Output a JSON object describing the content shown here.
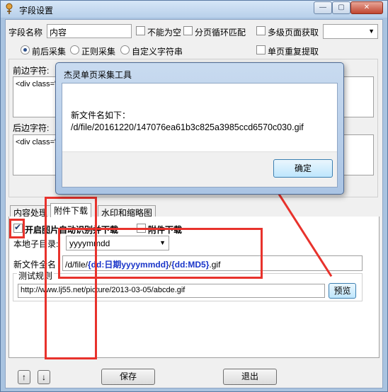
{
  "window": {
    "title": "字段设置",
    "min_glyph": "—",
    "max_glyph": "▢",
    "close_glyph": "✕"
  },
  "top": {
    "field_name_label": "字段名称",
    "field_name_value": "内容",
    "not_empty_label": "不能为空",
    "page_loop_label": "分页循环匹配",
    "multi_page_label": "多级页面获取",
    "multi_page_combo_value": "",
    "radio_before_after": "前后采集",
    "radio_regex": "正则采集",
    "radio_custom": "自定义字符串",
    "single_page_repeat_label": "单页重复提取",
    "before_label": "前边字符:",
    "before_value": "<div class=\"",
    "after_label": "后边字符:",
    "after_value": "<div class=\""
  },
  "tabs": {
    "items": [
      "内容处理",
      "附件下载",
      "水印和缩略图"
    ]
  },
  "attach": {
    "auto_detect_label": "开启图片自动识别并下载",
    "attach_download_label": "附件下载",
    "local_dir_label": "本地子目录:",
    "local_dir_value": "yyyymmdd",
    "new_name_label": "新文件全名",
    "new_name_prefix": "/d/file/",
    "new_name_date_token": "{dd:日期yyyymmdd}",
    "new_name_sep": "/",
    "new_name_md5_token": "{dd:MD5}",
    "new_name_suffix": ".gif",
    "test_rule_label": "测试规则",
    "test_url_value": "http://www.lj55.net/picture/2013-03-05/abcde.gif",
    "preview_button": "预览"
  },
  "bottom": {
    "up_arrow": "↑",
    "down_arrow": "↓",
    "save_button": "保存",
    "exit_button": "退出"
  },
  "dialog": {
    "title": "杰灵单页采集工具",
    "message_line1": "新文件名如下：",
    "message_line2": "/d/file/20161220/147076ea61b3c825a3985ccd6570c030.gif",
    "ok_button": "确定"
  },
  "colors": {
    "annotation_red": "#e8322c",
    "token_blue": "#1a35c9",
    "title_bar": "#b8d0ea"
  }
}
